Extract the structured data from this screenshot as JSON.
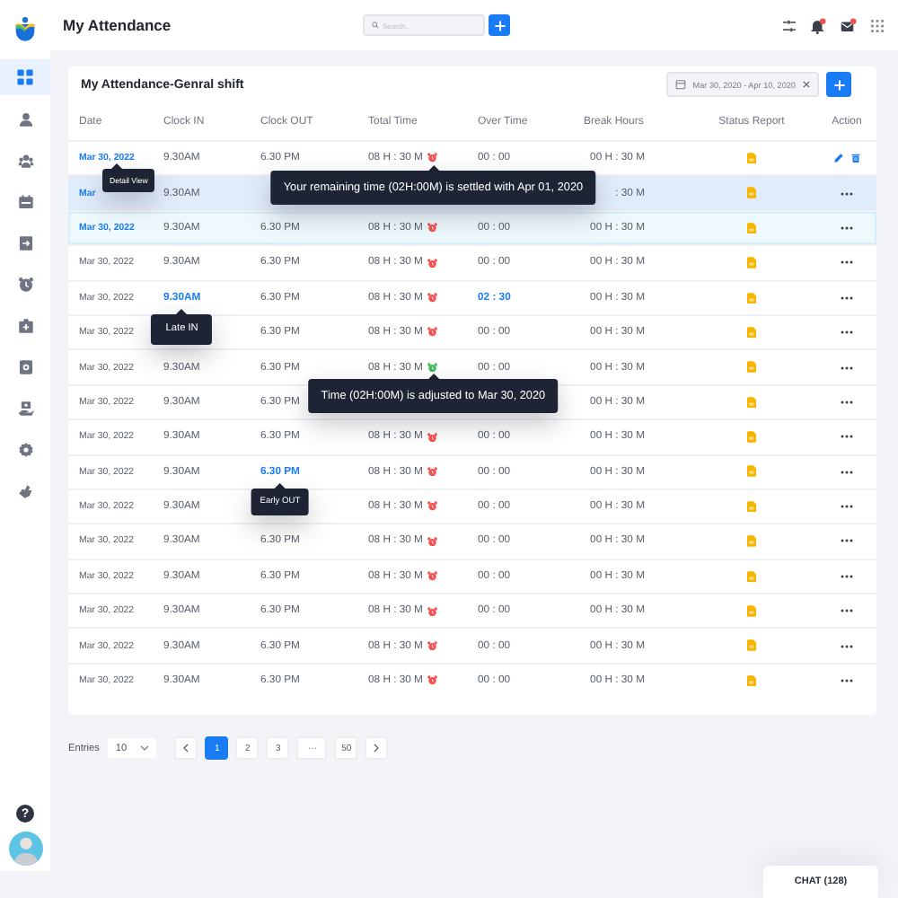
{
  "sidebar": {
    "items": [
      {
        "selected": true
      },
      {
        "selected": false
      },
      {
        "selected": false
      },
      {
        "selected": false
      },
      {
        "selected": false
      },
      {
        "selected": false
      },
      {
        "selected": false
      },
      {
        "selected": false
      },
      {
        "selected": false
      },
      {
        "selected": false
      },
      {
        "selected": false
      }
    ],
    "help": "?"
  },
  "header": {
    "title": "My Attendance",
    "search": {
      "placeholder": "Search..."
    }
  },
  "card": {
    "title": "My Attendance-Genral shift",
    "date_range": "Mar 30, 2020 - Apr 10, 2020"
  },
  "table": {
    "columns": [
      "Date",
      "Clock IN",
      "Clock OUT",
      "Total Time",
      "Over Time",
      "Break Hours",
      "Status Report",
      "Action"
    ],
    "rows": [
      {
        "date": "Mar 30, 2022",
        "date_link": true,
        "clock_in": "9.30AM",
        "late": false,
        "clock_out": "6.30 PM",
        "early": false,
        "total_time": "08 H : 30 M",
        "color": "#f5514f",
        "over_time": "00 : 00",
        "overtime_flag": false,
        "break_hours": "00 H : 30 M",
        "kind": "edit",
        "selected": false,
        "hovered": false,
        "date_tip": "Detail View",
        "total_time_tip": "Your remaining time (02H:00M) is settled with Apr 01, 2020"
      },
      {
        "date": "Mar",
        "date_link": true,
        "clock_in": "9.30AM",
        "late": false,
        "break_hours": ": 30 M",
        "kind": "more",
        "selected": true,
        "hovered": false
      },
      {
        "date": "Mar 30, 2022",
        "date_link": true,
        "clock_in": "9.30AM",
        "late": false,
        "clock_out": "6.30 PM",
        "early": false,
        "total_time": "08 H : 30 M",
        "color": "#f5514f",
        "over_time": "00 : 00",
        "overtime_flag": false,
        "break_hours": "00 H : 30 M",
        "kind": "more",
        "selected": false,
        "hovered": true
      },
      {
        "date": "Mar 30, 2022",
        "date_link": false,
        "clock_in": "9.30AM",
        "late": false,
        "clock_out": "6.30 PM",
        "early": false,
        "total_time": "08 H : 30 M",
        "color": "#f5514f",
        "over_time": "00 : 00",
        "overtime_flag": false,
        "break_hours": "00 H : 30 M",
        "kind": "more",
        "selected": false,
        "hovered": false
      },
      {
        "date": "Mar 30, 2022",
        "date_link": false,
        "clock_in": "9.30AM",
        "late": true,
        "clock_out": "6.30 PM",
        "early": false,
        "total_time": "08 H : 30 M",
        "color": "#f5514f",
        "over_time": "02 : 30",
        "overtime_flag": true,
        "break_hours": "00 H : 30 M",
        "kind": "more",
        "selected": false,
        "hovered": false,
        "clock_in_tip": "Late IN"
      },
      {
        "date": "Mar 30, 2022",
        "date_link": false,
        "clock_out": "6.30 PM",
        "early": false,
        "total_time": "08 H : 30 M",
        "color": "#f5514f",
        "over_time": "00 : 00",
        "overtime_flag": false,
        "break_hours": "00 H : 30 M",
        "kind": "more",
        "selected": false,
        "hovered": false
      },
      {
        "date": "Mar 30, 2022",
        "date_link": false,
        "clock_in": "9.30AM",
        "late": false,
        "clock_out": "6.30 PM",
        "early": false,
        "total_time": "08 H : 30 M",
        "color": "#3dbb5b",
        "over_time": "00 : 00",
        "overtime_flag": false,
        "break_hours": "00 H : 30 M",
        "kind": "more",
        "selected": false,
        "hovered": false,
        "total_time_tip": "Time (02H:00M) is adjusted to Mar 30, 2020"
      },
      {
        "date": "Mar 30, 2022",
        "date_link": false,
        "clock_in": "9.30AM",
        "late": false,
        "clock_out": "6.30 PM",
        "early": false,
        "break_hours": "00 H : 30 M",
        "kind": "more",
        "selected": false,
        "hovered": false
      },
      {
        "date": "Mar 30, 2022",
        "date_link": false,
        "clock_in": "9.30AM",
        "late": false,
        "clock_out": "6.30 PM",
        "early": false,
        "total_time": "08 H : 30 M",
        "color": "#f5514f",
        "over_time": "00 : 00",
        "overtime_flag": false,
        "break_hours": "00 H : 30 M",
        "kind": "more",
        "selected": false,
        "hovered": false
      },
      {
        "date": "Mar 30, 2022",
        "date_link": false,
        "clock_in": "9.30AM",
        "late": false,
        "clock_out": "6.30 PM",
        "early": true,
        "total_time": "08 H : 30 M",
        "color": "#f5514f",
        "over_time": "00 : 00",
        "overtime_flag": false,
        "break_hours": "00 H : 30 M",
        "kind": "more",
        "selected": false,
        "hovered": false,
        "clock_out_tip": "Early OUT"
      },
      {
        "date": "Mar 30, 2022",
        "date_link": false,
        "clock_in": "9.30AM",
        "late": false,
        "total_time": "08 H : 30 M",
        "color": "#f5514f",
        "over_time": "00 : 00",
        "overtime_flag": false,
        "break_hours": "00 H : 30 M",
        "kind": "more",
        "selected": false,
        "hovered": false
      },
      {
        "date": "Mar 30, 2022",
        "date_link": false,
        "clock_in": "9.30AM",
        "late": false,
        "clock_out": "6.30 PM",
        "early": false,
        "total_time": "08 H : 30 M",
        "color": "#f5514f",
        "over_time": "00 : 00",
        "overtime_flag": false,
        "break_hours": "00 H : 30 M",
        "kind": "more",
        "selected": false,
        "hovered": false
      },
      {
        "date": "Mar 30, 2022",
        "date_link": false,
        "clock_in": "9.30AM",
        "late": false,
        "clock_out": "6.30 PM",
        "early": false,
        "total_time": "08 H : 30 M",
        "color": "#f5514f",
        "over_time": "00 : 00",
        "overtime_flag": false,
        "break_hours": "00 H : 30 M",
        "kind": "more",
        "selected": false,
        "hovered": false
      },
      {
        "date": "Mar 30, 2022",
        "date_link": false,
        "clock_in": "9.30AM",
        "late": false,
        "clock_out": "6.30 PM",
        "early": false,
        "total_time": "08 H : 30 M",
        "color": "#f5514f",
        "over_time": "00 : 00",
        "overtime_flag": false,
        "break_hours": "00 H : 30 M",
        "kind": "more",
        "selected": false,
        "hovered": false
      },
      {
        "date": "Mar 30, 2022",
        "date_link": false,
        "clock_in": "9.30AM",
        "late": false,
        "clock_out": "6.30 PM",
        "early": false,
        "total_time": "08 H : 30 M",
        "color": "#f5514f",
        "over_time": "00 : 00",
        "overtime_flag": false,
        "break_hours": "00 H : 30 M",
        "kind": "more",
        "selected": false,
        "hovered": false
      },
      {
        "date": "Mar 30, 2022",
        "date_link": false,
        "clock_in": "9.30AM",
        "late": false,
        "clock_out": "6.30 PM",
        "early": false,
        "total_time": "08 H : 30 M",
        "color": "#f5514f",
        "over_time": "00 : 00",
        "overtime_flag": false,
        "break_hours": "00 H : 30 M",
        "kind": "more",
        "selected": false,
        "hovered": false
      }
    ]
  },
  "pagination": {
    "label": "Entries",
    "page_size": "10",
    "pages": [
      {
        "label": "1",
        "selected": true
      },
      {
        "label": "2",
        "selected": false
      },
      {
        "label": "3",
        "selected": false
      },
      {
        "label": "···",
        "selected": false
      },
      {
        "label": "50",
        "selected": false
      }
    ]
  },
  "chat": {
    "label": "CHAT (128)"
  }
}
